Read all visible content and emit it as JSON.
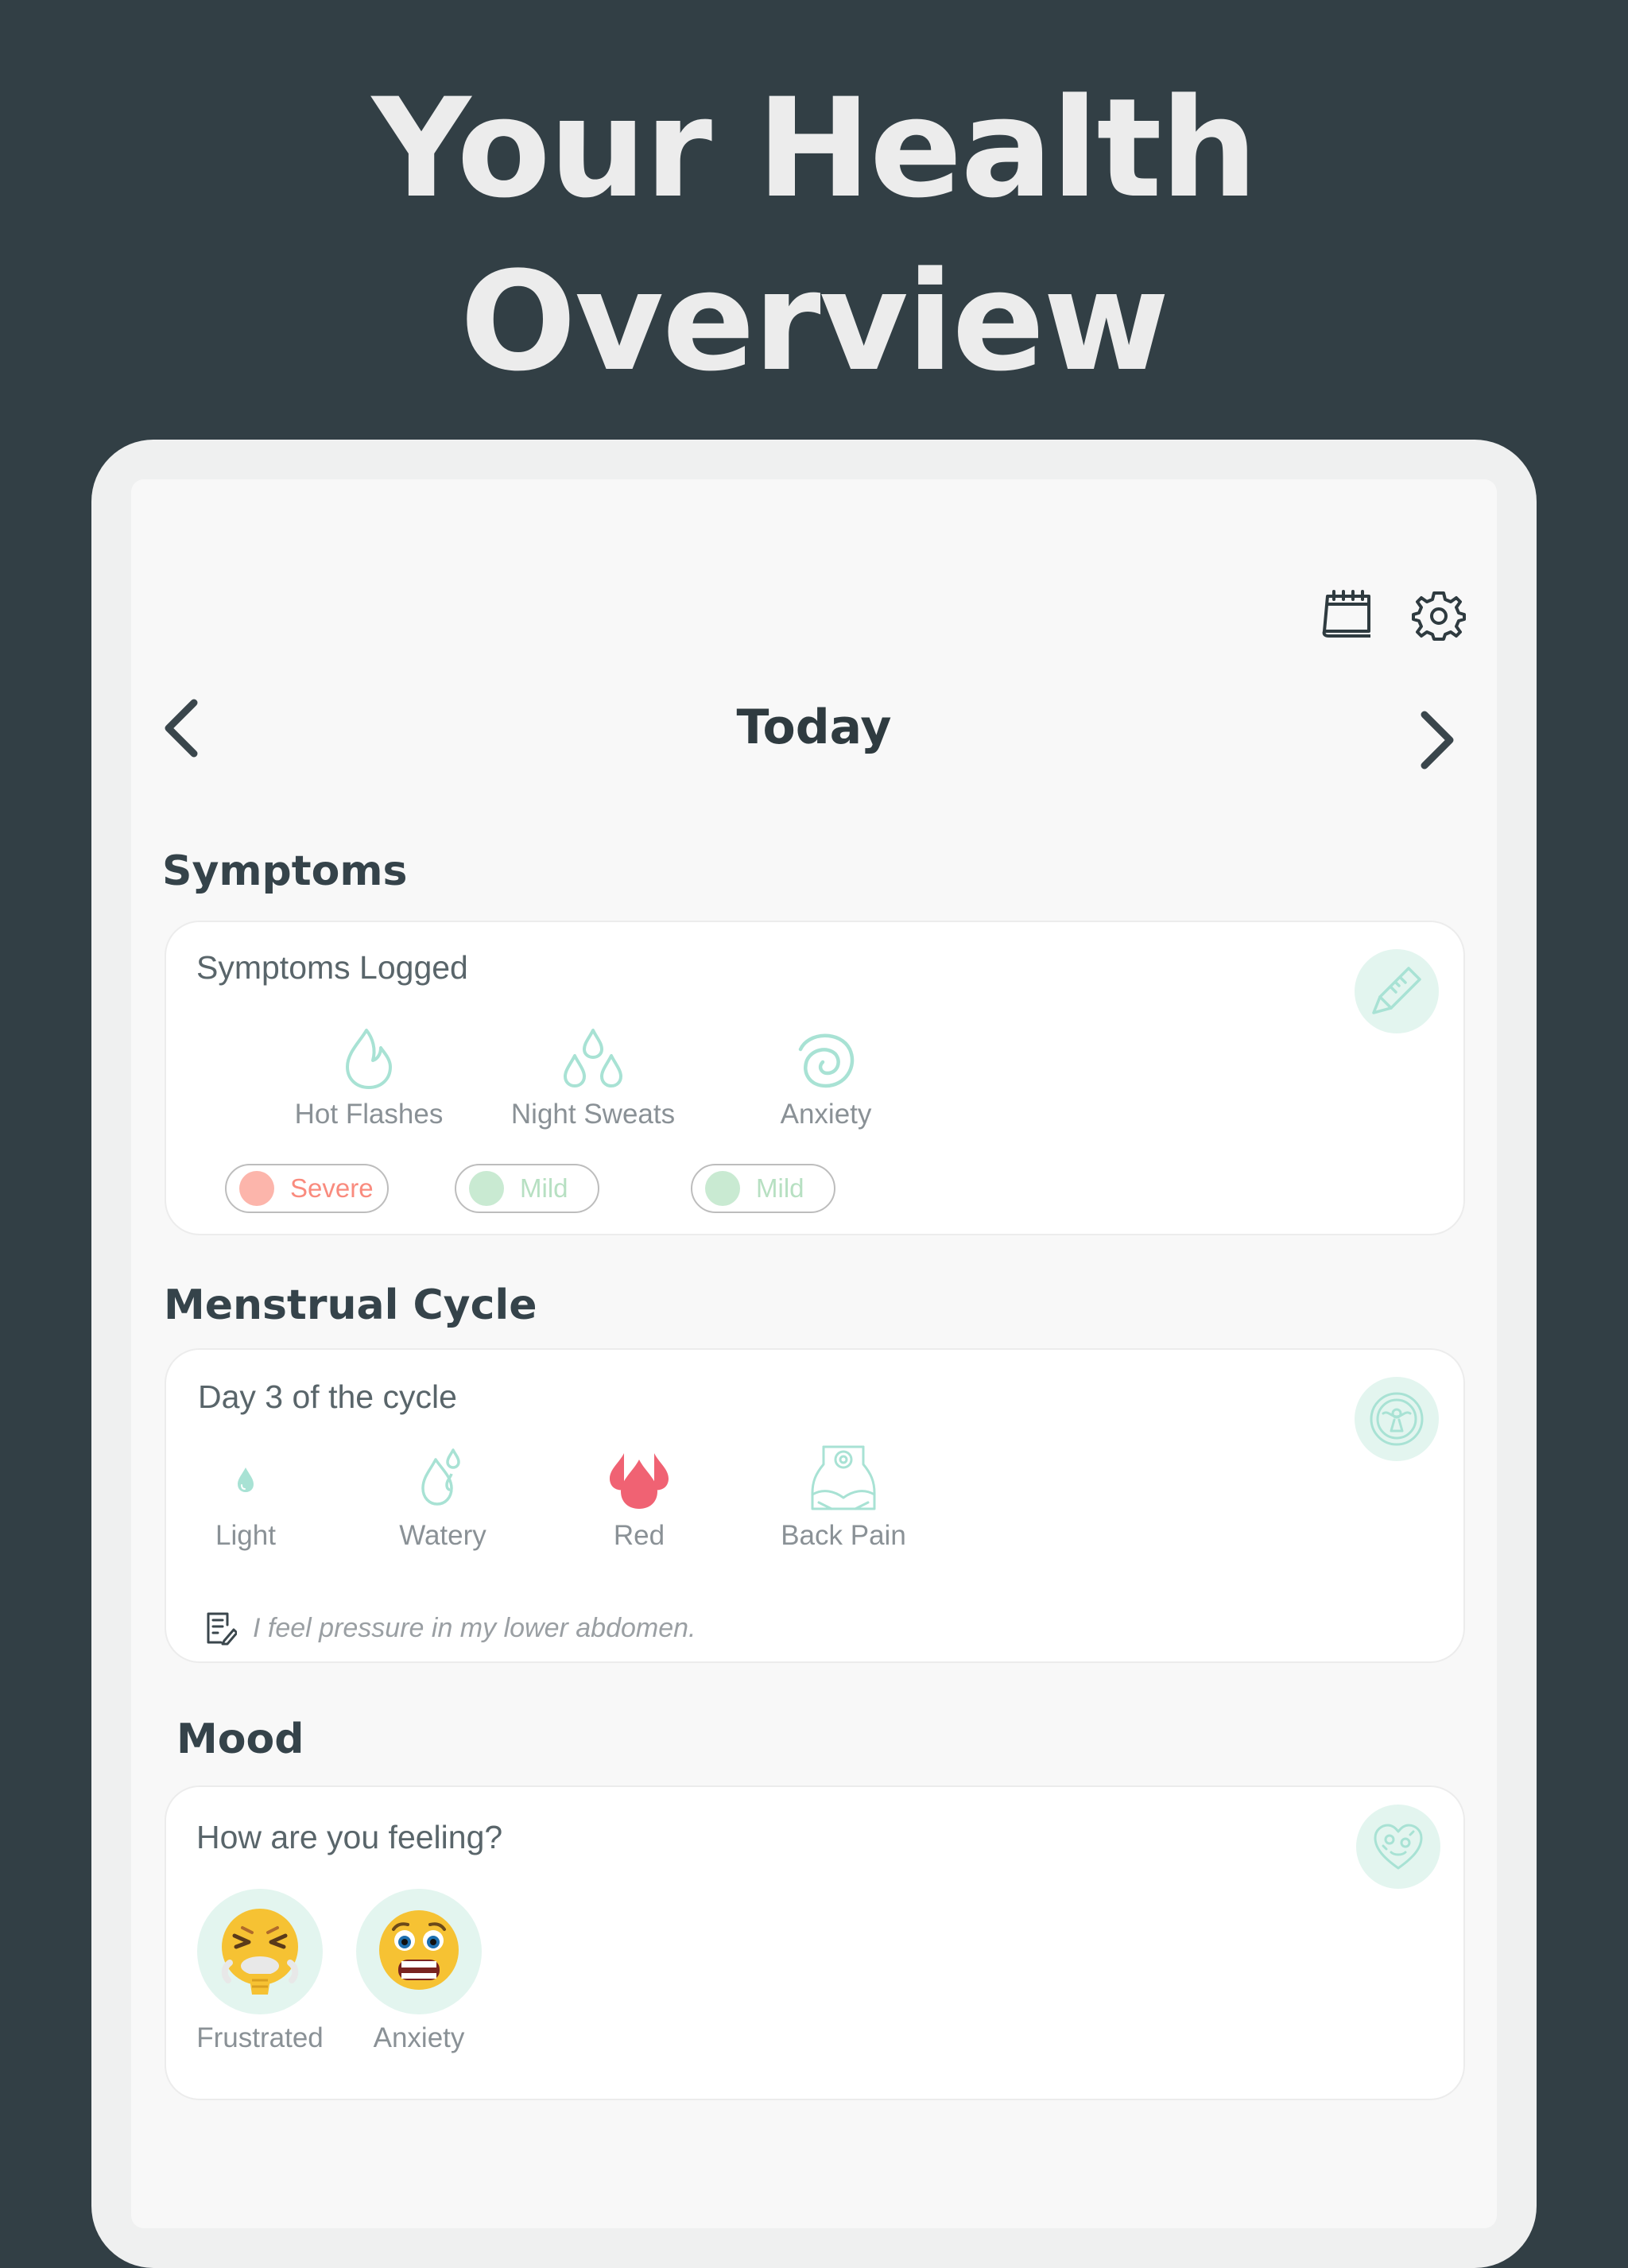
{
  "hero": {
    "line1": "Your Health",
    "line2": "Overview"
  },
  "header": {
    "date_title": "Today"
  },
  "symptoms": {
    "section_title": "Symptoms",
    "card_title": "Symptoms Logged",
    "items": [
      {
        "label": "Hot Flashes",
        "icon": "flame-icon",
        "severity": "Severe",
        "severity_color": "#f98b7e",
        "dot_color": "#fcb5ab"
      },
      {
        "label": "Night Sweats",
        "icon": "droplets-icon",
        "severity": "Mild",
        "severity_color": "#b7e0c2",
        "dot_color": "#c9ead2"
      },
      {
        "label": "Anxiety",
        "icon": "spiral-icon",
        "severity": "Mild",
        "severity_color": "#b7e0c2",
        "dot_color": "#c9ead2"
      }
    ]
  },
  "cycle": {
    "section_title": "Menstrual Cycle",
    "card_title": "Day 3 of the cycle",
    "items": [
      {
        "label": "Light",
        "icon": "light-drop-icon"
      },
      {
        "label": "Watery",
        "icon": "watery-drops-icon"
      },
      {
        "label": "Red",
        "icon": "red-drops-icon"
      },
      {
        "label": "Back Pain",
        "icon": "back-pain-icon"
      }
    ],
    "note": "I feel pressure in my lower abdomen."
  },
  "mood": {
    "section_title": "Mood",
    "card_title": "How are you feeling?",
    "items": [
      {
        "label": "Frustrated",
        "icon": "frustrated-emoji-icon"
      },
      {
        "label": "Anxiety",
        "icon": "anxious-emoji-icon"
      }
    ]
  },
  "colors": {
    "background": "#323f45",
    "accent_mint": "#a8e2d4",
    "accent_red": "#f06273",
    "badge_bg": "#e3f5ef"
  }
}
